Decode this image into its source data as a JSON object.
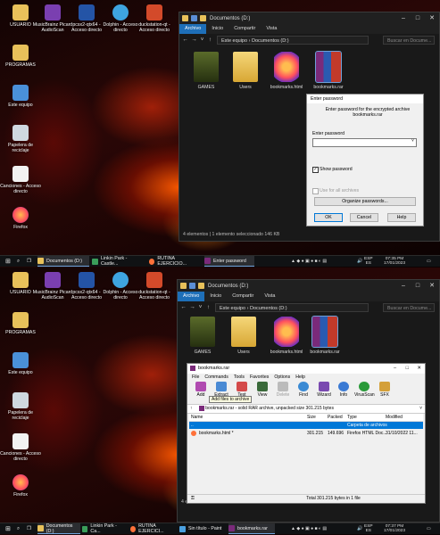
{
  "desktop_icons": [
    {
      "label": "USUARIO"
    },
    {
      "label": "MusicBrainz Picard AudioScan"
    },
    {
      "label": "pcsx2-qtx64 - Acceso directo"
    },
    {
      "label": "Dolphin - Acceso directo"
    },
    {
      "label": "duckstation-qt - Acceso directo"
    },
    {
      "label": "PROGRAMAS"
    },
    {
      "label": "Este equipo"
    },
    {
      "label": "Papelera de reciclaje"
    },
    {
      "label": "Canciones - Acceso directo"
    },
    {
      "label": "Firefox"
    }
  ],
  "top": {
    "explorer": {
      "title": "Documentos (D:)",
      "tabs": [
        "Archivo",
        "Inicio",
        "Compartir",
        "Vista"
      ],
      "breadcrumb": [
        "Este equipo",
        "Documentos (D:)"
      ],
      "search_placeholder": "Buscar en Docume...",
      "files": [
        "GAMES",
        "Users",
        "bookmarks.html",
        "bookmarks.rar"
      ],
      "status_items": "4 elementos",
      "status_selected": "1 elemento seleccionado  146 KB"
    },
    "dialog": {
      "title": "Enter password",
      "message": "Enter password for the encrypted archive bookmarks.rar",
      "field_label": "Enter password",
      "password_value": "",
      "show_password": "Show password",
      "use_all": "Use for all archives",
      "organize": "Organize passwords...",
      "ok": "OK",
      "cancel": "Cancel",
      "help": "Help"
    },
    "taskbar": {
      "items": [
        "Documentos (D:)",
        "Linkin Park - Castle...",
        "RUTINA EJERCICIO...",
        "Enter password"
      ],
      "tray_lang": "ESP",
      "tray_region": "ES",
      "time": "07:35 PM",
      "date": "17/01/2023"
    }
  },
  "bottom": {
    "explorer": {
      "title": "Documentos (D:)",
      "tabs": [
        "Archivo",
        "Inicio",
        "Compartir",
        "Vista"
      ],
      "breadcrumb": [
        "Este equipo",
        "Documentos (D:)"
      ],
      "search_placeholder": "Buscar en Docume...",
      "files": [
        "GAMES",
        "Users",
        "bookmarks.html",
        "bookmarks.rar"
      ],
      "status_items": "4 elementos",
      "status_selected": "1 elemento seleccionado  146 KB"
    },
    "winrar": {
      "title": "bookmarks.rar",
      "menu": [
        "File",
        "Commands",
        "Tools",
        "Favorites",
        "Options",
        "Help"
      ],
      "toolbar": [
        "Add",
        "Extract To",
        "Test",
        "View",
        "Delete",
        "Find",
        "Wizard",
        "Info",
        "VirusScan",
        "SFX"
      ],
      "tooltip": "Add files to archive",
      "path": "bookmarks.rar - solid RAR archive, unpacked size 301.215 bytes",
      "columns": [
        "Name",
        "Size",
        "Packed",
        "Type",
        "Modified"
      ],
      "rows": [
        {
          "name": "..",
          "size": "",
          "packed": "",
          "type": "Carpeta de archivos",
          "modified": ""
        },
        {
          "name": "bookmarks.html *",
          "size": "301.215",
          "packed": "149.696",
          "type": "Firefox HTML Doc...",
          "modified": "31/10/2022 11..."
        }
      ],
      "status": "Total 301.215 bytes in 1 file"
    },
    "taskbar": {
      "items": [
        "Documentos (D:)",
        "Linkin Park - Ca...",
        "RUTINA EJERCICI...",
        "Sin título - Paint",
        "bookmarks.rar"
      ],
      "tray_lang": "ESP",
      "tray_region": "ES",
      "time": "07:37 PM",
      "date": "17/01/2023"
    }
  },
  "colors": {
    "accent": "#1e6fb8",
    "explorer_bg": "#191919",
    "taskbar_bg": "#101214"
  }
}
